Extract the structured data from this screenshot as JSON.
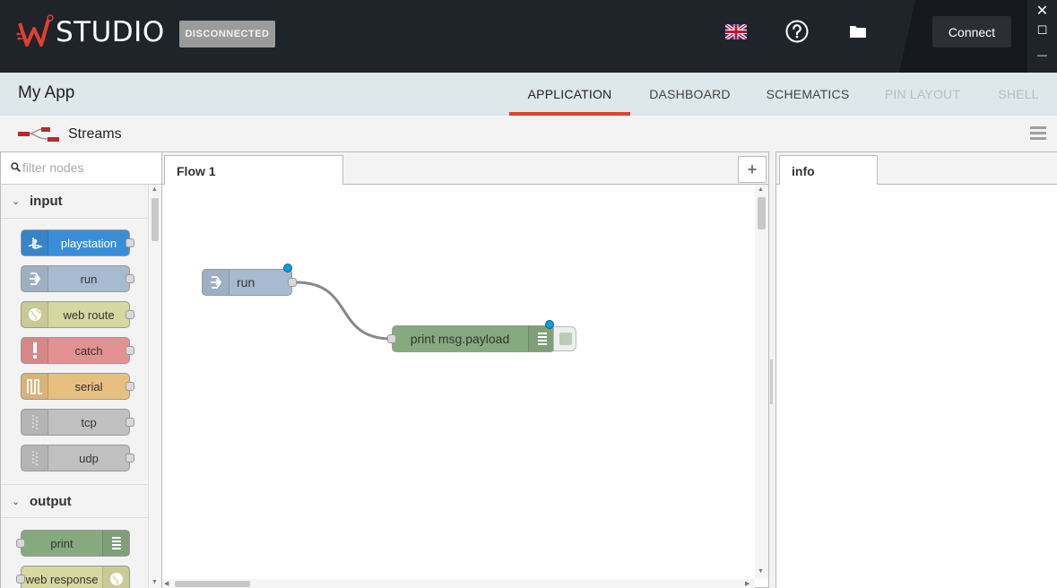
{
  "brand": {
    "logo_text": "STUDIO",
    "accent": "#e0412e"
  },
  "status": {
    "label": "DISCONNECTED"
  },
  "top_icons": [
    "uk-flag-icon",
    "help-icon",
    "folder-icon"
  ],
  "connect": {
    "label": "Connect"
  },
  "window_controls": {
    "close": "✕",
    "maximize": "☐",
    "minimize": "—"
  },
  "app": {
    "title": "My App"
  },
  "tabs": [
    {
      "label": "APPLICATION",
      "state": "active"
    },
    {
      "label": "DASHBOARD",
      "state": "normal"
    },
    {
      "label": "SCHEMATICS",
      "state": "normal"
    },
    {
      "label": "PIN LAYOUT",
      "state": "disabled"
    },
    {
      "label": "SHELL",
      "state": "disabled"
    }
  ],
  "streams": {
    "label": "Streams"
  },
  "palette": {
    "filter_placeholder": "filter nodes",
    "sections": [
      {
        "label": "input",
        "nodes": [
          {
            "label": "playstation",
            "color": "#3a8ed8",
            "icon": "playstation-icon"
          },
          {
            "label": "run",
            "color": "#a6bbcf",
            "icon": "arrow-in-icon"
          },
          {
            "label": "web route",
            "color": "#d7d7a0",
            "icon": "globe-icon"
          },
          {
            "label": "catch",
            "color": "#e49191",
            "icon": "alert-icon"
          },
          {
            "label": "serial",
            "color": "#e7bf80",
            "icon": "serial-icon"
          },
          {
            "label": "tcp",
            "color": "#c0c0c0",
            "icon": "bridge-icon"
          },
          {
            "label": "udp",
            "color": "#c0c0c0",
            "icon": "bridge-icon"
          }
        ]
      },
      {
        "label": "output",
        "nodes": [
          {
            "label": "print",
            "color": "#87a980",
            "icon": "list-icon"
          },
          {
            "label": "web response",
            "color": "#d7d7a0",
            "icon": "globe-icon"
          }
        ]
      }
    ]
  },
  "workspace": {
    "tab_label": "Flow 1",
    "add_label": "+",
    "nodes": [
      {
        "label": "run",
        "color": "#a6bbcf"
      },
      {
        "label": "print msg.payload",
        "color": "#87a980"
      }
    ]
  },
  "sidebar": {
    "tab_label": "info"
  }
}
